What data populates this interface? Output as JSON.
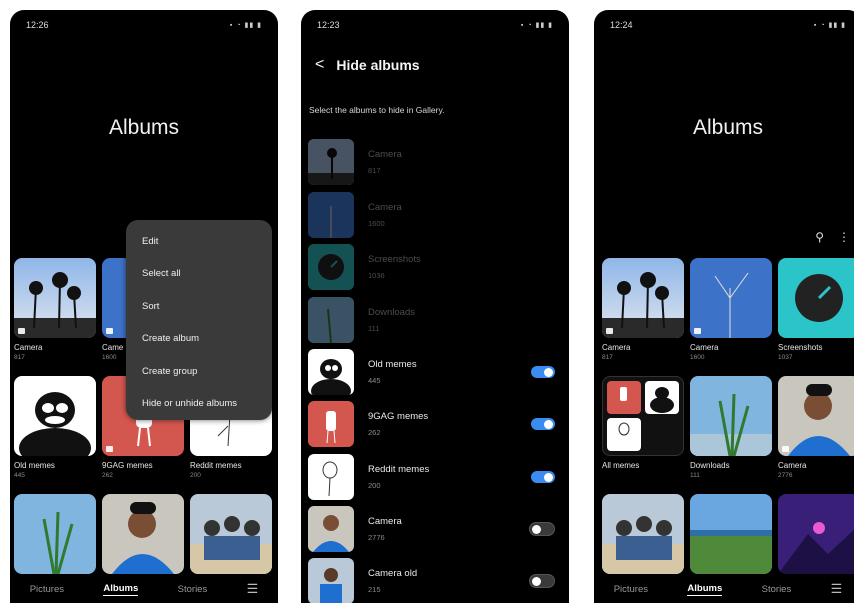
{
  "screen1": {
    "time": "12:26",
    "title": "Albums",
    "albums": [
      {
        "name": "Camera",
        "count": "817"
      },
      {
        "name": "Came",
        "count": "1600"
      },
      {
        "name": "Old memes",
        "count": "445"
      },
      {
        "name": "9GAG memes",
        "count": "262"
      },
      {
        "name": "Reddit memes",
        "count": "200"
      }
    ],
    "menu": [
      "Edit",
      "Select all",
      "Sort",
      "Create album",
      "Create group",
      "Hide or unhide albums"
    ],
    "tabs": {
      "pictures": "Pictures",
      "albums": "Albums",
      "stories": "Stories"
    }
  },
  "screen2": {
    "time": "12:23",
    "title": "Hide albums",
    "subtitle": "Select the albums to hide in Gallery.",
    "rows": [
      {
        "name": "Camera",
        "count": "817",
        "state": "dim"
      },
      {
        "name": "Camera",
        "count": "1600",
        "state": "dim"
      },
      {
        "name": "Screenshots",
        "count": "1036",
        "state": "dim"
      },
      {
        "name": "Downloads",
        "count": "111",
        "state": "dim"
      },
      {
        "name": "Old memes",
        "count": "445",
        "state": "on"
      },
      {
        "name": "9GAG memes",
        "count": "262",
        "state": "on"
      },
      {
        "name": "Reddit memes",
        "count": "200",
        "state": "on"
      },
      {
        "name": "Camera",
        "count": "2776",
        "state": "off"
      },
      {
        "name": "Camera old",
        "count": "215",
        "state": "off"
      }
    ]
  },
  "screen3": {
    "time": "12:24",
    "title": "Albums",
    "albums": [
      {
        "name": "Camera",
        "count": "817"
      },
      {
        "name": "Camera",
        "count": "1600"
      },
      {
        "name": "Screenshots",
        "count": "1037"
      },
      {
        "name": "All memes",
        "count": ""
      },
      {
        "name": "Downloads",
        "count": "111"
      },
      {
        "name": "Camera",
        "count": "2776"
      }
    ],
    "tabs": {
      "pictures": "Pictures",
      "albums": "Albums",
      "stories": "Stories"
    }
  },
  "icons": {
    "back": "chevron-left-icon",
    "search": "search-icon",
    "more": "more-vertical-icon",
    "menu": "hamburger-menu-icon"
  },
  "colors": {
    "toggle_on": "#3b8cf0",
    "menu_bg": "#3a3a3a",
    "background": "#000000"
  }
}
